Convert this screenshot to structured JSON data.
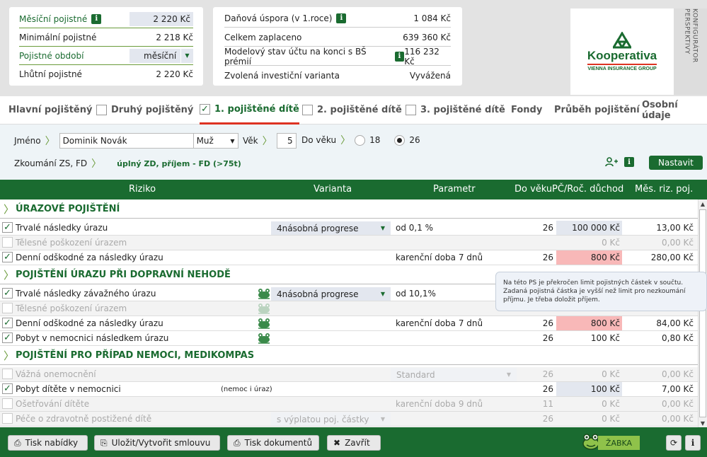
{
  "summary_left": [
    {
      "label": "Měsíční pojistné",
      "value": "2 220 Kč",
      "type": "box",
      "info": true
    },
    {
      "label": "Minimální pojistné",
      "value": "2 218 Kč",
      "type": "plain"
    },
    {
      "label": "Pojistné období",
      "value": "měsíční",
      "type": "select"
    },
    {
      "label": "Lhůtní pojistné",
      "value": "2 220 Kč",
      "type": "plain"
    }
  ],
  "summary_right": [
    {
      "label": "Daňová úspora (v 1.roce)",
      "value": "1 084 Kč",
      "info": true
    },
    {
      "label": "Celkem zaplaceno",
      "value": "639 360 Kč",
      "info": false
    },
    {
      "label": "Modelový stav účtu na konci s BŠ prémií",
      "value": "116 232 Kč",
      "info": true
    },
    {
      "label": "Zvolená investiční varianta",
      "value": "Vyvážená",
      "info": false
    }
  ],
  "logo": {
    "name": "Kooperativa",
    "sub": "VIENNA INSURANCE GROUP"
  },
  "vertical_label": "KONFIGURÁTOR PERSPEKTIVY",
  "tabs": [
    {
      "label": "Hlavní pojištěný",
      "checkbox": false,
      "checked": false,
      "active": false
    },
    {
      "label": "Druhý pojištěný",
      "checkbox": true,
      "checked": false,
      "active": false
    },
    {
      "label": "1. pojištěné dítě",
      "checkbox": true,
      "checked": true,
      "active": true
    },
    {
      "label": "2. pojištěné dítě",
      "checkbox": true,
      "checked": false,
      "active": false
    },
    {
      "label": "3. pojištěné dítě",
      "checkbox": true,
      "checked": false,
      "active": false
    },
    {
      "label": "Fondy",
      "checkbox": false,
      "checked": false,
      "active": false
    },
    {
      "label": "Průběh pojištění",
      "checkbox": false,
      "checked": false,
      "active": false
    },
    {
      "label": "Osobní údaje",
      "checkbox": false,
      "checked": false,
      "active": false
    }
  ],
  "form": {
    "name_label": "Jméno",
    "name_value": "Dominik Novák",
    "gender": "Muž",
    "age_label": "Věk",
    "age_value": "5",
    "to_age_label": "Do věku",
    "to_age_options": [
      "18",
      "26"
    ],
    "to_age_selected": "26",
    "exam_label": "Zkoumání ZS, FD",
    "exam_value": "úplný ZD, příjem - FD (>75t)",
    "set_button": "Nastavit"
  },
  "table_header": {
    "riziko": "Riziko",
    "varianta": "Varianta",
    "parametr": "Parametr",
    "do_veku": "Do věku",
    "pc": "PČ/Roč. důchod",
    "mes": "Měs. riz. poj."
  },
  "rows": [
    {
      "kind": "section",
      "title": "ÚRAZOVÉ POJIŠTĚNÍ"
    },
    {
      "kind": "item",
      "label": "Trvalé následky úrazu",
      "checked": true,
      "disabled": false,
      "frog": false,
      "variant": "4násobná progrese",
      "param": "od 0,1 %",
      "age": "26",
      "pc": "100 000 Kč",
      "pc_style": "blue",
      "mes": "13,00 Kč"
    },
    {
      "kind": "item",
      "label": "Tělesné poškození úrazem",
      "checked": false,
      "disabled": true,
      "frog": false,
      "variant": "",
      "param": "",
      "age": "",
      "pc": "0 Kč",
      "pc_style": "",
      "mes": "0,00 Kč"
    },
    {
      "kind": "item",
      "label": "Denní odškodné za následky úrazu",
      "checked": true,
      "disabled": false,
      "frog": false,
      "variant": "",
      "param": "karenční doba 7 dnů",
      "age": "26",
      "pc": "800 Kč",
      "pc_style": "red",
      "mes": "280,00 Kč"
    },
    {
      "kind": "section",
      "title": "POJIŠTĚNÍ ÚRAZU PŘI DOPRAVNÍ NEHODĚ"
    },
    {
      "kind": "item",
      "label": "Trvalé následky závažného úrazu",
      "checked": true,
      "disabled": false,
      "frog": true,
      "variant": "4násobná progrese",
      "param": "od 10,1%",
      "age": "",
      "pc": "",
      "pc_style": "",
      "mes": ""
    },
    {
      "kind": "item",
      "label": "Tělesné poškození úrazem",
      "checked": false,
      "disabled": true,
      "frog": true,
      "variant": "",
      "param": "",
      "age": "",
      "pc": "",
      "pc_style": "",
      "mes": ""
    },
    {
      "kind": "item",
      "label": "Denní odškodné za následky úrazu",
      "checked": true,
      "disabled": false,
      "frog": true,
      "variant": "",
      "param": "karenční doba 7 dnů",
      "age": "26",
      "pc": "800 Kč",
      "pc_style": "red",
      "mes": "84,00 Kč"
    },
    {
      "kind": "item",
      "label": "Pobyt v nemocnici následkem úrazu",
      "checked": true,
      "disabled": false,
      "frog": true,
      "variant": "",
      "param": "",
      "age": "26",
      "pc": "100 Kč",
      "pc_style": "",
      "mes": "0,80 Kč"
    },
    {
      "kind": "section",
      "title": "POJIŠTĚNÍ PRO PŘÍPAD NEMOCI, MEDIKOMPAS"
    },
    {
      "kind": "item",
      "label": "Vážná onemocnění",
      "checked": false,
      "disabled": true,
      "frog": false,
      "variant": "",
      "param": "Standard",
      "param_select": true,
      "age": "26",
      "pc": "0 Kč",
      "pc_style": "",
      "mes": "0,00 Kč"
    },
    {
      "kind": "item",
      "label": "Pobyt dítěte v nemocnici",
      "note": "(nemoc i úraz)",
      "checked": true,
      "disabled": false,
      "frog": false,
      "variant": "",
      "param": "",
      "age": "26",
      "pc": "100 Kč",
      "pc_style": "blue",
      "mes": "7,00 Kč"
    },
    {
      "kind": "item",
      "label": "Ošetřování dítěte",
      "checked": false,
      "disabled": true,
      "frog": false,
      "variant": "",
      "param": "karenční doba 9 dnů",
      "age": "11",
      "pc": "0 Kč",
      "pc_style": "",
      "mes": "0,00 Kč"
    },
    {
      "kind": "item",
      "label": "Péče o zdravotně postižené dítě",
      "checked": false,
      "disabled": true,
      "frog": false,
      "variant": "s výplatou poj. částky",
      "param": "",
      "age": "26",
      "pc": "0 Kč",
      "pc_style": "",
      "mes": "0,00 Kč"
    }
  ],
  "tooltip": {
    "line1": "Na této PS je překročen limit pojistných částek v součtu.",
    "line2": "Zadaná pojistná částka je vyšší než limit pro nezkoumání příjmu. Je třeba doložit příjem."
  },
  "footer": {
    "print_offer": "Tisk nabídky",
    "save": "Uložit/Vytvořit smlouvu",
    "print_docs": "Tisk dokumentů",
    "close": "Zavřít",
    "zabka": "ŽABKA"
  },
  "colors": {
    "brand_green": "#1a6b30",
    "accent_red": "#dd3322",
    "highlight_red": "#f8b8b8",
    "light_blue": "#e3e7ef"
  }
}
